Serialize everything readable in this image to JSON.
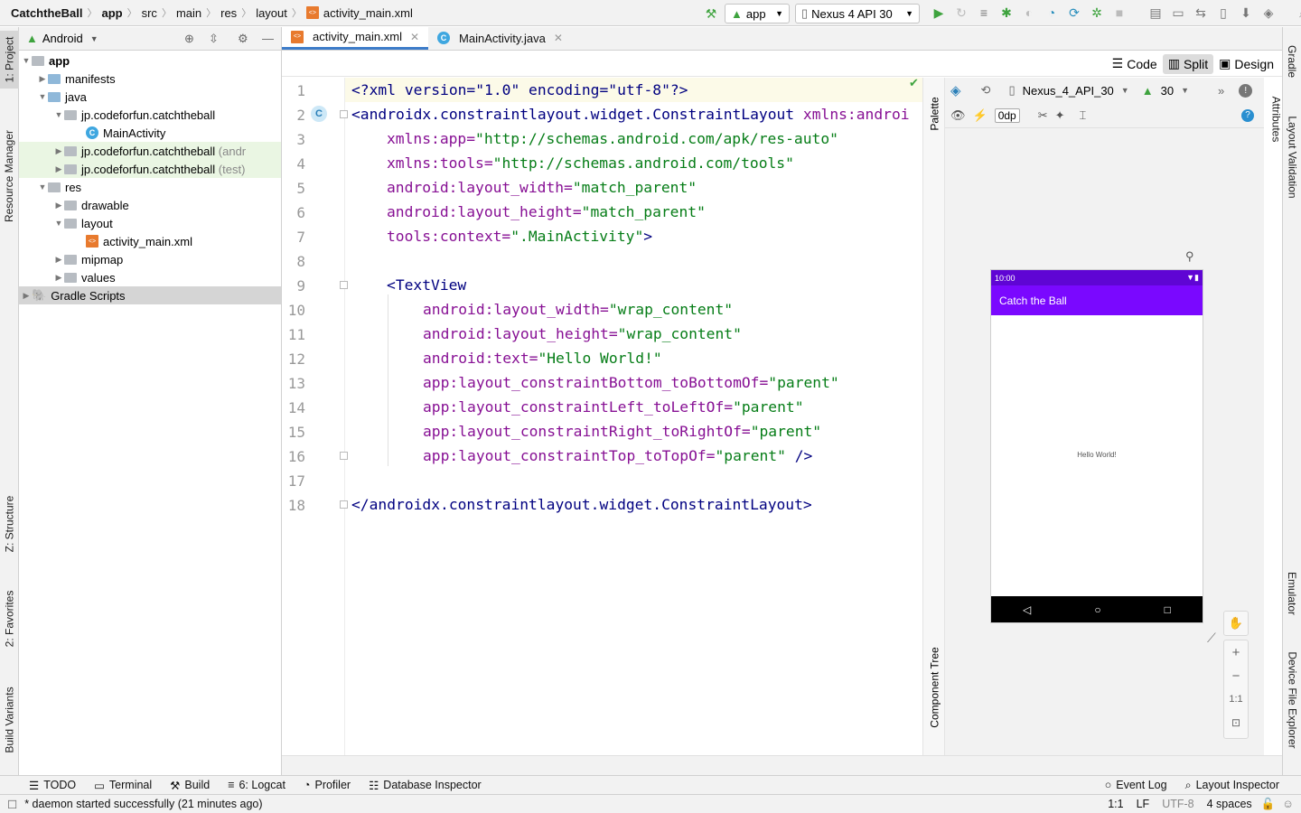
{
  "breadcrumb": {
    "project": "CatchtheBall",
    "module": "app",
    "parts": [
      "src",
      "main",
      "res",
      "layout"
    ],
    "file": "activity_main.xml"
  },
  "run_config": {
    "module": "app",
    "device": "Nexus 4 API 30"
  },
  "project_panel": {
    "view": "Android",
    "tree": [
      {
        "label": "app",
        "suffix": "",
        "bold": true
      },
      {
        "label": "manifests",
        "suffix": ""
      },
      {
        "label": "java",
        "suffix": ""
      },
      {
        "label": "jp.codeforfun.catchtheball",
        "suffix": ""
      },
      {
        "label": "MainActivity",
        "suffix": ""
      },
      {
        "label": "jp.codeforfun.catchtheball",
        "suffix": "(andr"
      },
      {
        "label": "jp.codeforfun.catchtheball",
        "suffix": "(test)"
      },
      {
        "label": "res",
        "suffix": ""
      },
      {
        "label": "drawable",
        "suffix": ""
      },
      {
        "label": "layout",
        "suffix": ""
      },
      {
        "label": "activity_main.xml",
        "suffix": ""
      },
      {
        "label": "mipmap",
        "suffix": ""
      },
      {
        "label": "values",
        "suffix": ""
      },
      {
        "label": "Gradle Scripts",
        "suffix": ""
      }
    ]
  },
  "left_tabs": {
    "project": "1: Project",
    "resource": "Resource Manager",
    "structure": "Z: Structure",
    "favorites": "2: Favorites",
    "variants": "Build Variants"
  },
  "right_tabs": {
    "gradle": "Gradle",
    "validation": "Layout Validation",
    "attributes": "Attributes",
    "emulator": "Emulator",
    "explorer": "Device File Explorer"
  },
  "editor_tabs": [
    {
      "label": "activity_main.xml"
    },
    {
      "label": "MainActivity.java"
    }
  ],
  "view_modes": {
    "code": "Code",
    "split": "Split",
    "design": "Design"
  },
  "code_lines": [
    "1",
    "2",
    "3",
    "4",
    "5",
    "6",
    "7",
    "8",
    "9",
    "10",
    "11",
    "12",
    "13",
    "14",
    "15",
    "16",
    "17",
    "18"
  ],
  "code": {
    "l1": "<?xml version=\"1.0\" encoding=\"utf-8\"?>",
    "l2_tag": "<androidx.constraintlayout.widget.ConstraintLayout ",
    "l2_attr": "xmlns:androi",
    "l3_attr": "xmlns:app=",
    "l3_val": "\"http://schemas.android.com/apk/res-auto\"",
    "l4_attr": "xmlns:tools=",
    "l4_val": "\"http://schemas.android.com/tools\"",
    "l5_attr": "android:layout_width=",
    "l5_val": "\"match_parent\"",
    "l6_attr": "android:layout_height=",
    "l6_val": "\"match_parent\"",
    "l7_attr": "tools:context=",
    "l7_val": "\".MainActivity\"",
    "l7_end": ">",
    "l9_open": "<",
    "l9_tag": "TextView",
    "l10_attr": "android:layout_width=",
    "l10_val": "\"wrap_content\"",
    "l11_attr": "android:layout_height=",
    "l11_val": "\"wrap_content\"",
    "l12_attr": "android:text=",
    "l12_val": "\"Hello World!\"",
    "l13_attr": "app:layout_constraintBottom_toBottomOf=",
    "l13_val": "\"parent\"",
    "l14_attr": "app:layout_constraintLeft_toLeftOf=",
    "l14_val": "\"parent\"",
    "l15_attr": "app:layout_constraintRight_toRightOf=",
    "l15_val": "\"parent\"",
    "l16_attr": "app:layout_constraintTop_toTopOf=",
    "l16_val": "\"parent\"",
    "l16_end": " />",
    "l18": "</androidx.constraintlayout.widget.ConstraintLayout>"
  },
  "design": {
    "device": "Nexus_4_API_30",
    "api": "30",
    "margin": "0dp",
    "palette": "Palette",
    "component_tree": "Component Tree",
    "phone": {
      "time": "10:00",
      "app_title": "Catch the Ball",
      "hello": "Hello World!"
    },
    "zoom": {
      "in": "+",
      "out": "−",
      "fit": "1:1"
    }
  },
  "tool_windows": {
    "todo": "TODO",
    "terminal": "Terminal",
    "build": "Build",
    "logcat": "6: Logcat",
    "profiler": "Profiler",
    "db": "Database Inspector",
    "event_log": "Event Log",
    "layout_inspector": "Layout Inspector"
  },
  "status": {
    "message": "* daemon started successfully (21 minutes ago)",
    "pos": "1:1",
    "sep": "LF",
    "enc": "UTF-8",
    "indent": "4 spaces"
  },
  "colors": {
    "accent": "#3d7cc9",
    "app_bar": "#7a08ff",
    "status_bar": "#5f05d4",
    "run_green": "#3ea33e"
  }
}
